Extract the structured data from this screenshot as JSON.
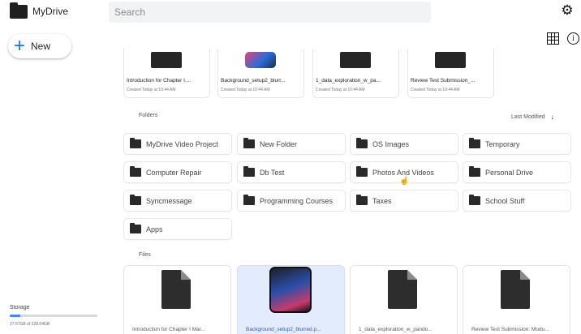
{
  "app": {
    "title": "MyDrive"
  },
  "search": {
    "placeholder": "Search"
  },
  "new_button": {
    "label": "New"
  },
  "storage": {
    "title": "Storage",
    "used_fraction": 0.12,
    "text": "27.57GB of 228.04GB"
  },
  "icons": {
    "settings": "gear-icon",
    "grid_view": "grid-icon",
    "info": "info-icon"
  },
  "colors": {
    "accent": "#1a73e8",
    "selected": "#e3ecfc"
  },
  "recent": [
    {
      "name": "Introduction for Chapter I....",
      "meta": "Created Today at 10:44 AM",
      "thumb": "doc"
    },
    {
      "name": "Background_setup2_blurr...",
      "meta": "Created Today at 10:44 AM",
      "thumb": "image"
    },
    {
      "name": "1_data_exploration_w_pa...",
      "meta": "Created Today at 10:44 AM",
      "thumb": "doc"
    },
    {
      "name": "Review Test Submission_...",
      "meta": "Created Today at 10:44 AM",
      "thumb": "doc"
    }
  ],
  "sections": {
    "folders": "Folders",
    "files": "Files",
    "sort": "Last Modified"
  },
  "folders": [
    "MyDrive Video Project",
    "New Folder",
    "OS Images",
    "Temporary",
    "Computer Repair",
    "Db Test",
    "Photos And Videos",
    "Personal Drive",
    "Syncmessage",
    "Programming Courses",
    "Taxes",
    "School Stuff",
    "Apps"
  ],
  "files": [
    {
      "name": "Introduction for Chapter I Mar...",
      "type": "doc",
      "selected": false
    },
    {
      "name": "Background_setup2_blurred.p...",
      "type": "image",
      "selected": true
    },
    {
      "name": "1_data_exploration_w_pando...",
      "type": "doc",
      "selected": false
    },
    {
      "name": "Review Test Submission: Modu...",
      "type": "doc",
      "selected": false
    }
  ]
}
